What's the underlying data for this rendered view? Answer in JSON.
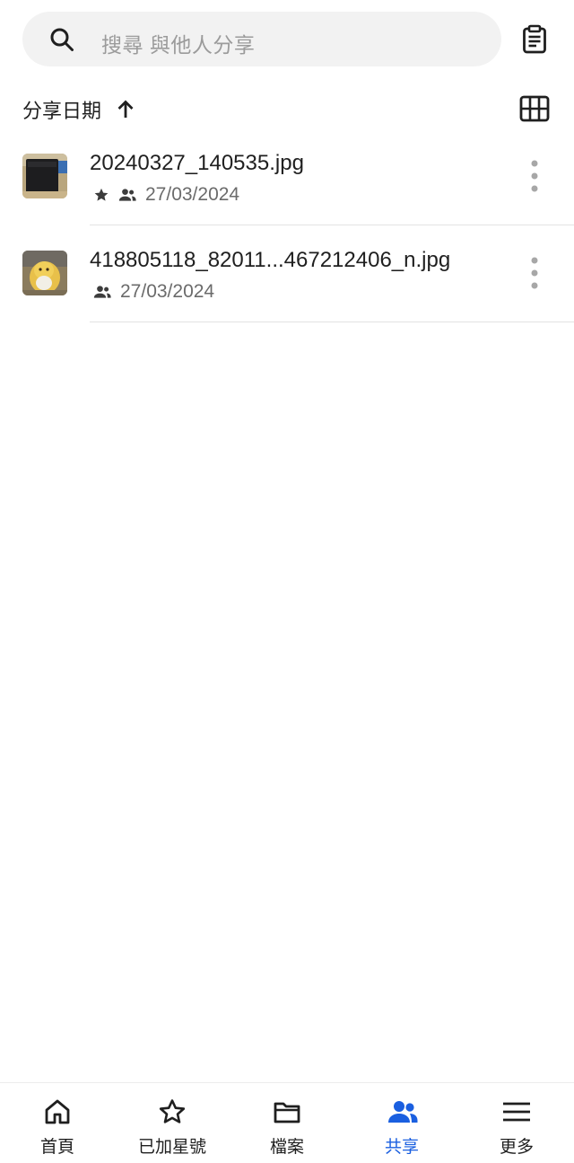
{
  "search": {
    "placeholder": "搜尋 與他人分享"
  },
  "sort": {
    "label": "分享日期"
  },
  "files": [
    {
      "name": "20240327_140535.jpg",
      "date": "27/03/2024",
      "starred": true,
      "shared": true
    },
    {
      "name": "418805118_82011...467212406_n.jpg",
      "date": "27/03/2024",
      "starred": false,
      "shared": true
    }
  ],
  "nav": {
    "items": [
      {
        "label": "首頁",
        "icon": "home-icon"
      },
      {
        "label": "已加星號",
        "icon": "star-outline-icon"
      },
      {
        "label": "檔案",
        "icon": "folder-icon"
      },
      {
        "label": "共享",
        "icon": "people-icon"
      },
      {
        "label": "更多",
        "icon": "menu-icon"
      }
    ],
    "active_index": 3
  },
  "colors": {
    "accent": "#1a5fe0",
    "search_bg": "#f2f2f2",
    "divider": "#e3e3e3"
  }
}
